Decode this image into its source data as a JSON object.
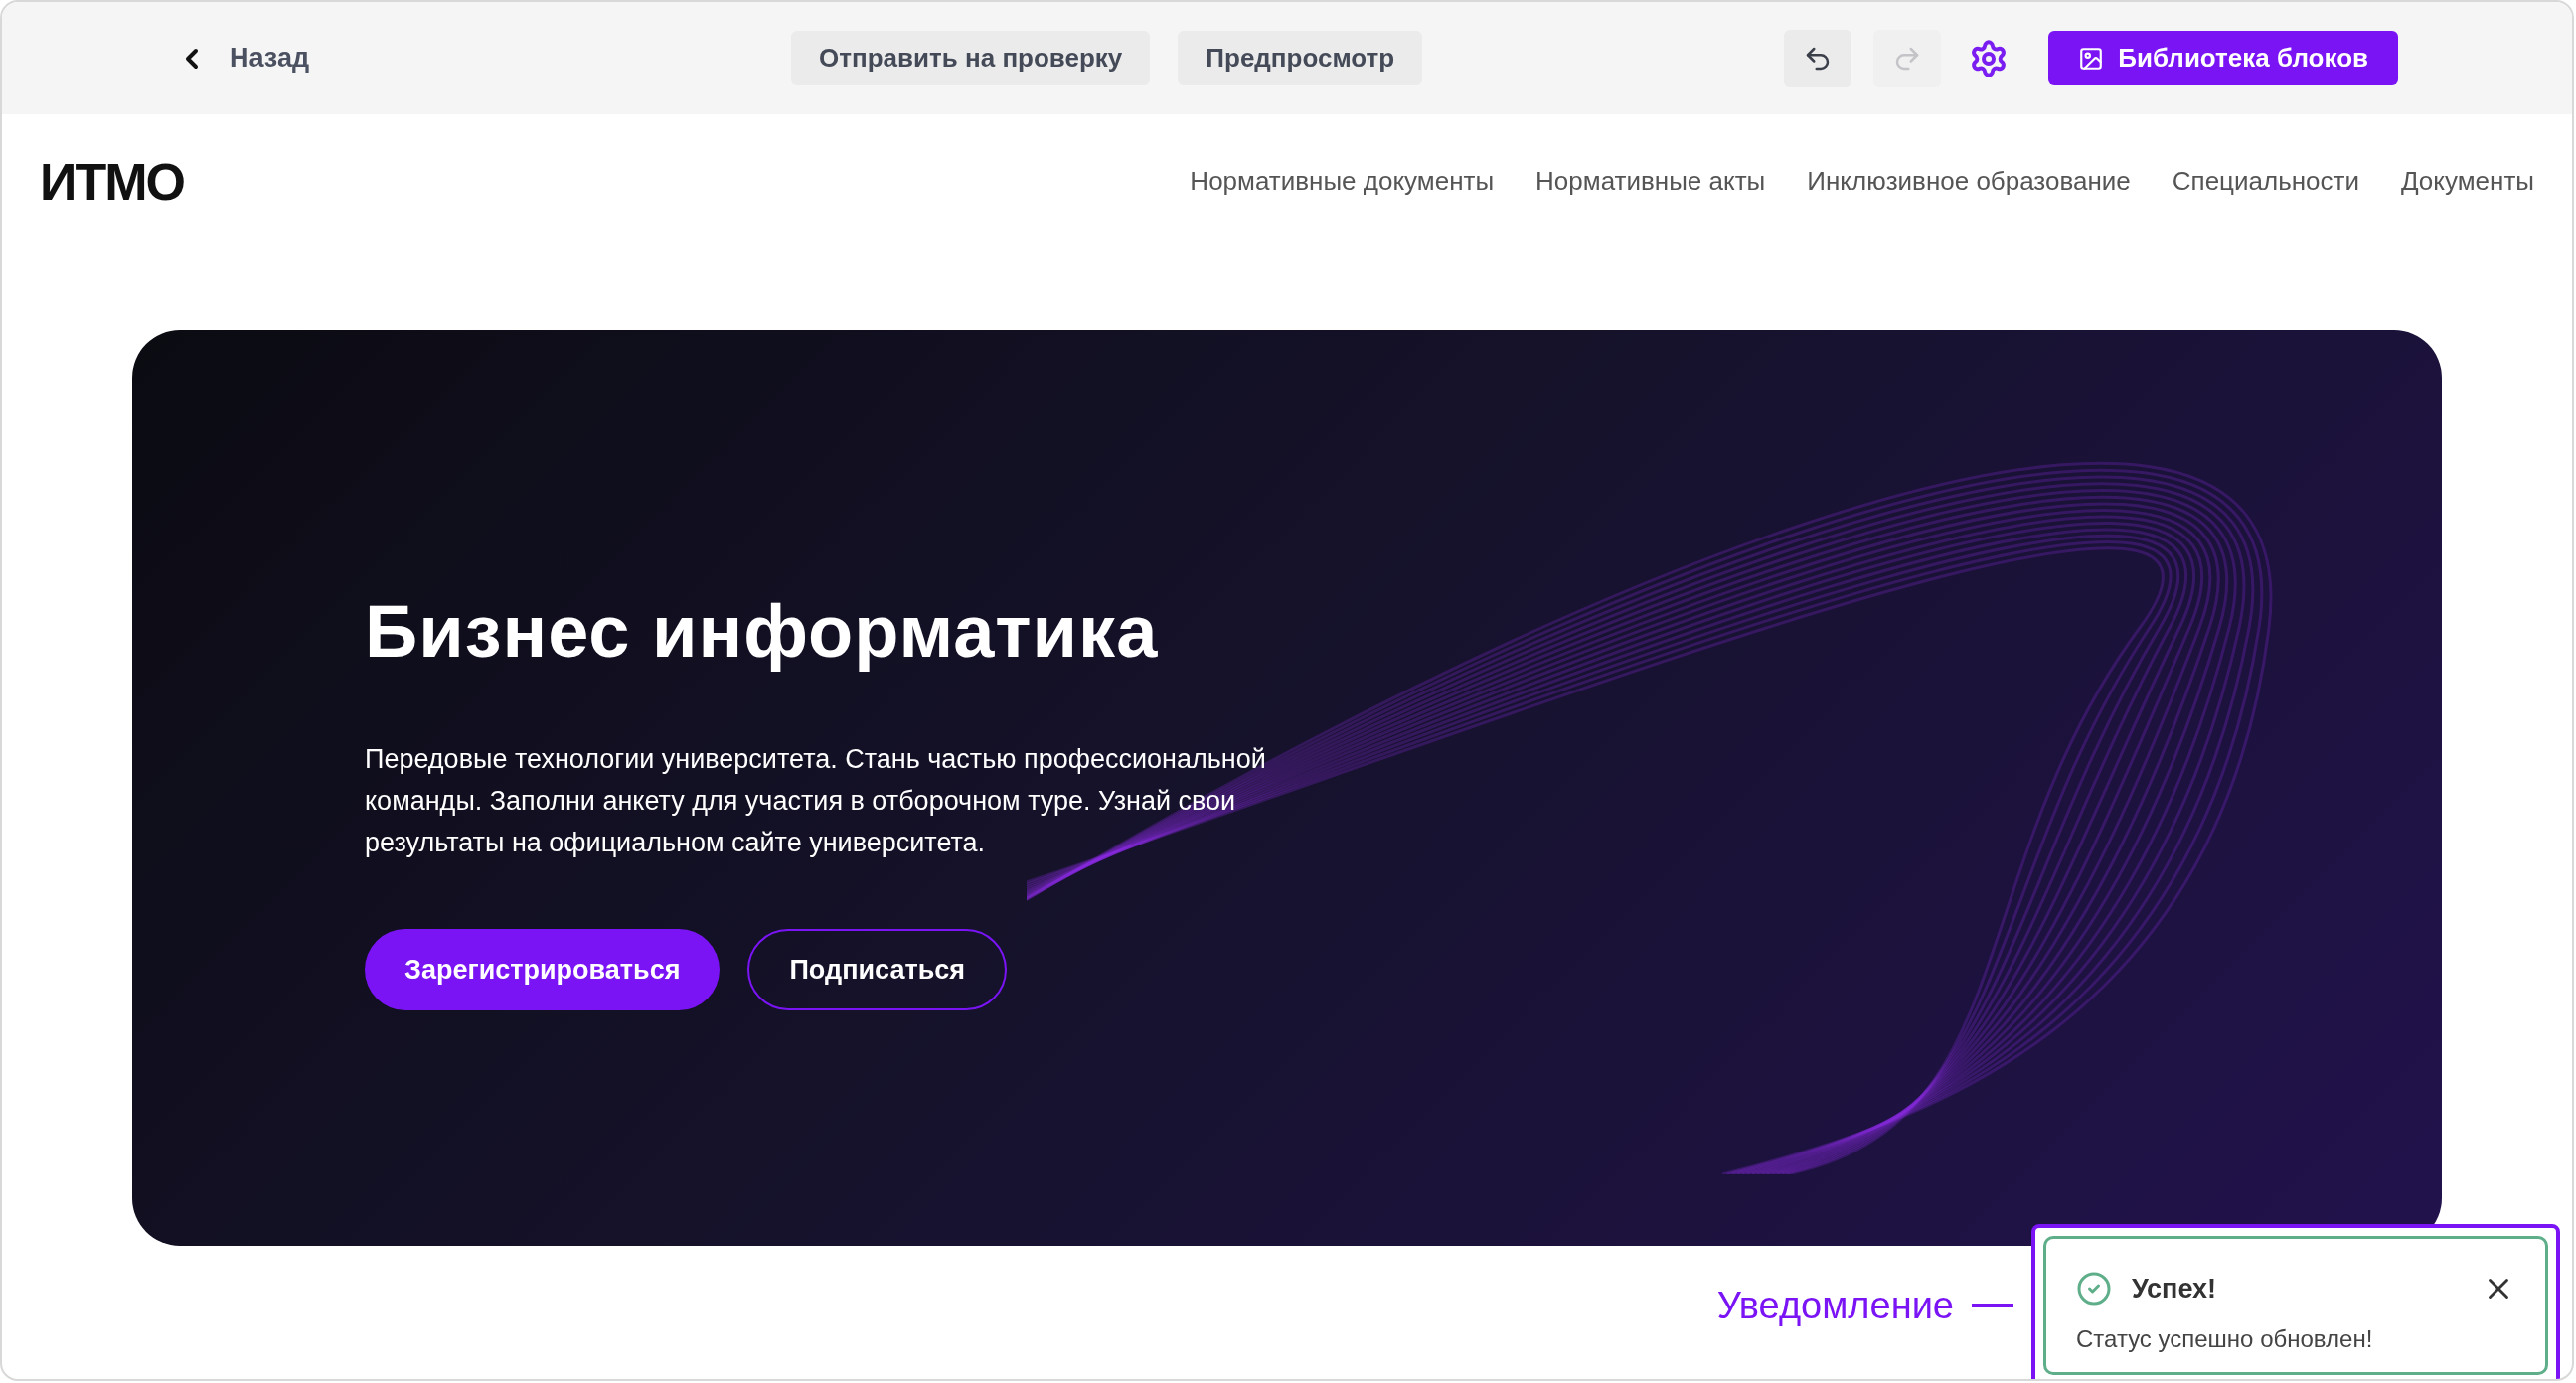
{
  "toolbar": {
    "back": "Назад",
    "actions": [
      "Отправить на проверку",
      "Предпросмотр"
    ],
    "undo": {
      "disabled": false
    },
    "redo": {
      "disabled": true
    },
    "library": "Библиотека блоков"
  },
  "header": {
    "logo": "ИТМО",
    "nav": [
      "Нормативные документы",
      "Нормативные акты",
      "Инклюзивное образование",
      "Специальности",
      "Документы"
    ]
  },
  "hero": {
    "title": "Бизнес информатика",
    "text": "Передовые технологии университета. Стань частью профессиональной команды. Заполни анкету для участия в отборочном туре. Узнай свои результаты на официальном сайте университета.",
    "primary": "Зарегистрироваться",
    "secondary": "Подписаться"
  },
  "callout": "Уведомление",
  "toast": {
    "title": "Успех!",
    "message": "Статус успешно обновлен!"
  }
}
